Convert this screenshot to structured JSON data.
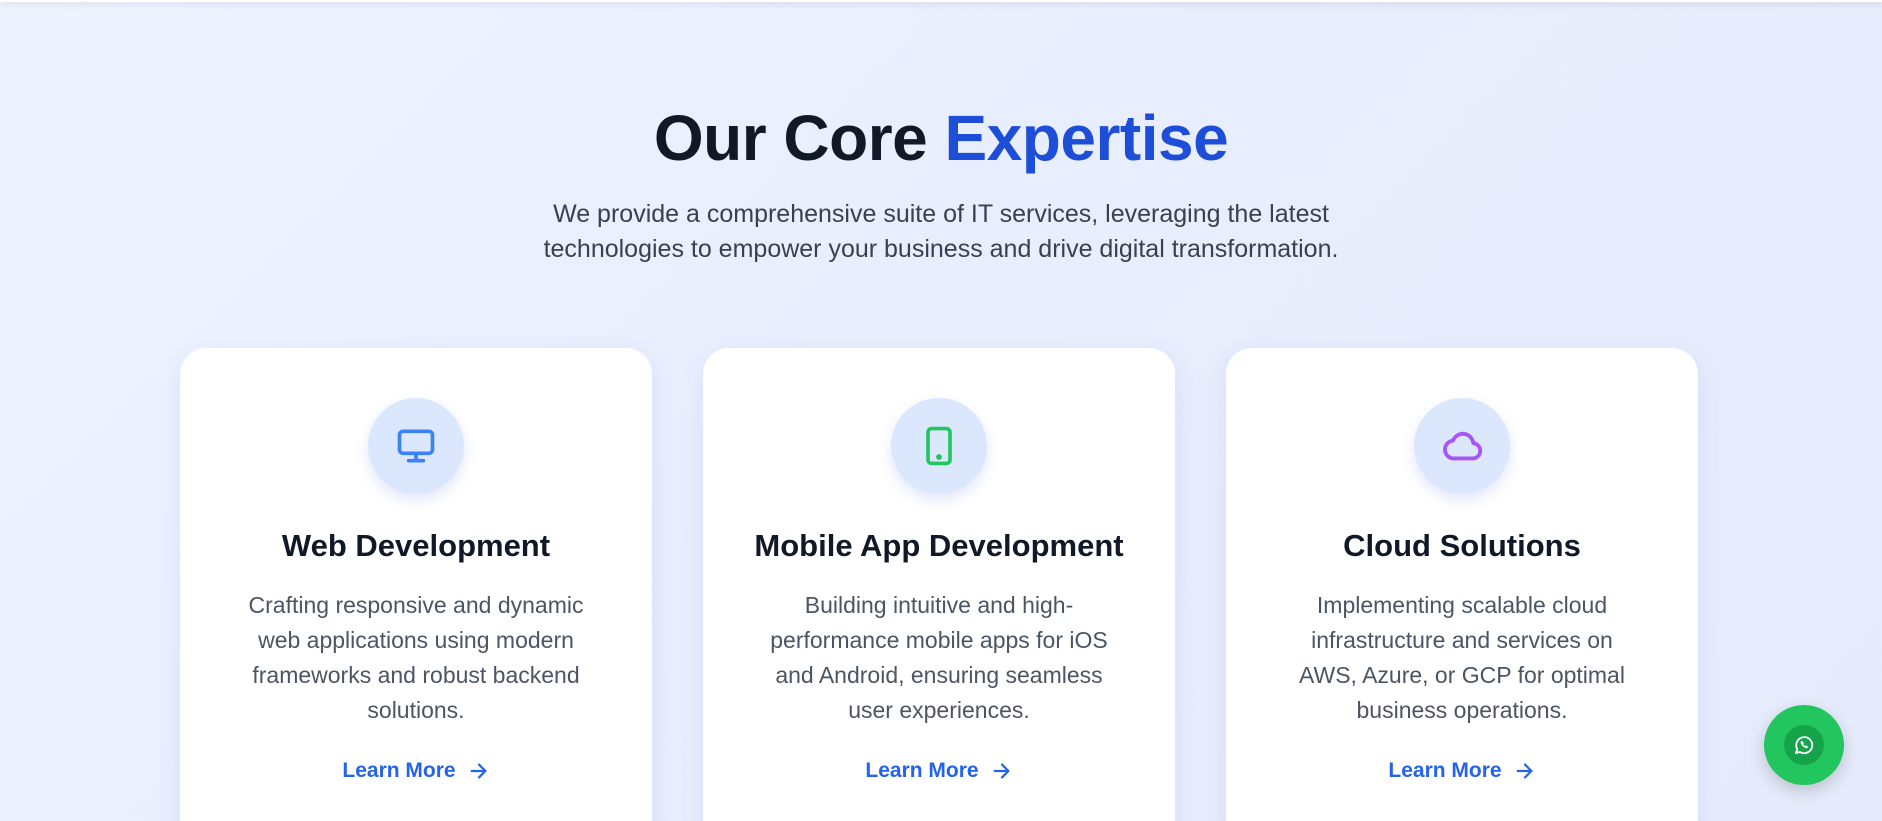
{
  "header": {
    "title_main": "Our Core ",
    "title_accent": "Expertise",
    "subtitle": "We provide a comprehensive suite of IT services, leveraging the latest technologies to empower your business and drive digital transformation."
  },
  "services": [
    {
      "icon": "monitor-icon",
      "icon_color": "#3b82f6",
      "title": "Web Development",
      "description": "Crafting responsive and dynamic web applications using modern frameworks and robust backend solutions.",
      "link_label": "Learn More"
    },
    {
      "icon": "tablet-icon",
      "icon_color": "#22c55e",
      "title": "Mobile App Development",
      "description": "Building intuitive and high-performance mobile apps for iOS and Android, ensuring seamless user experiences.",
      "link_label": "Learn More"
    },
    {
      "icon": "cloud-icon",
      "icon_color": "#a855f7",
      "title": "Cloud Solutions",
      "description": "Implementing scalable cloud infrastructure and services on AWS, Azure, or GCP for optimal business operations.",
      "link_label": "Learn More"
    }
  ],
  "colors": {
    "accent": "#1d4ed8",
    "link": "#2563eb",
    "whatsapp": "#22c55e"
  },
  "floating": {
    "icon": "whatsapp-icon"
  }
}
